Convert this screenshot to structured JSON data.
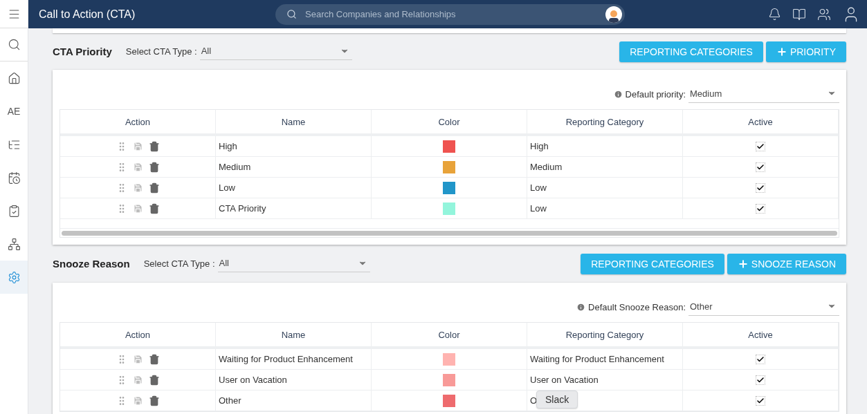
{
  "sidebar": {
    "items": [
      {
        "kind": "menu",
        "selected": false
      },
      {
        "kind": "search",
        "selected": false
      },
      {
        "kind": "home",
        "selected": false
      },
      {
        "kind": "text",
        "label": "AE",
        "selected": false
      },
      {
        "kind": "list",
        "selected": false
      },
      {
        "kind": "clock",
        "selected": false
      },
      {
        "kind": "clipboard",
        "selected": false
      },
      {
        "kind": "tree",
        "selected": false
      },
      {
        "kind": "gear",
        "selected": true
      }
    ]
  },
  "header": {
    "title": "Call to Action (CTA)",
    "search": {
      "placeholder": "Search Companies and Relationships"
    }
  },
  "sections": [
    {
      "title": "CTA Priority",
      "type_label": "Select CTA Type :",
      "type_value": "All",
      "buttons": [
        {
          "label": "REPORTING CATEGORIES",
          "kind": "plain"
        },
        {
          "label": "PRIORITY",
          "kind": "add"
        }
      ],
      "default_label": "Default priority:",
      "default_value": "Medium",
      "scrollbar": true,
      "columns": [
        "Action",
        "Name",
        "Color",
        "Reporting Category",
        "Active"
      ],
      "rows": [
        {
          "name": "High",
          "color": "#ef5350",
          "category": "High",
          "active": true
        },
        {
          "name": "Medium",
          "color": "#e8a33a",
          "category": "Medium",
          "active": true
        },
        {
          "name": "Low",
          "color": "#2196c9",
          "category": "Low",
          "active": true
        },
        {
          "name": "CTA Priority",
          "color": "#93f5dc",
          "category": "Low",
          "active": true
        }
      ]
    },
    {
      "title": "Snooze Reason",
      "type_label": "Select CTA Type :",
      "type_value": "All",
      "buttons": [
        {
          "label": "REPORTING CATEGORIES",
          "kind": "plain"
        },
        {
          "label": "SNOOZE REASON",
          "kind": "add"
        }
      ],
      "default_label": "Default Snooze Reason:",
      "default_value": "Other",
      "scrollbar": false,
      "columns": [
        "Action",
        "Name",
        "Color",
        "Reporting Category",
        "Active"
      ],
      "rows": [
        {
          "name": "Waiting for Product Enhancement",
          "color": "#ffb3b0",
          "category": "Waiting for Product Enhancement",
          "active": true
        },
        {
          "name": "User on Vacation",
          "color": "#f89a98",
          "category": "User on Vacation",
          "active": true
        },
        {
          "name": "Other",
          "color": "#ee6b6e",
          "category": "O",
          "active": true
        }
      ]
    }
  ],
  "tooltip": {
    "text": "Slack"
  }
}
